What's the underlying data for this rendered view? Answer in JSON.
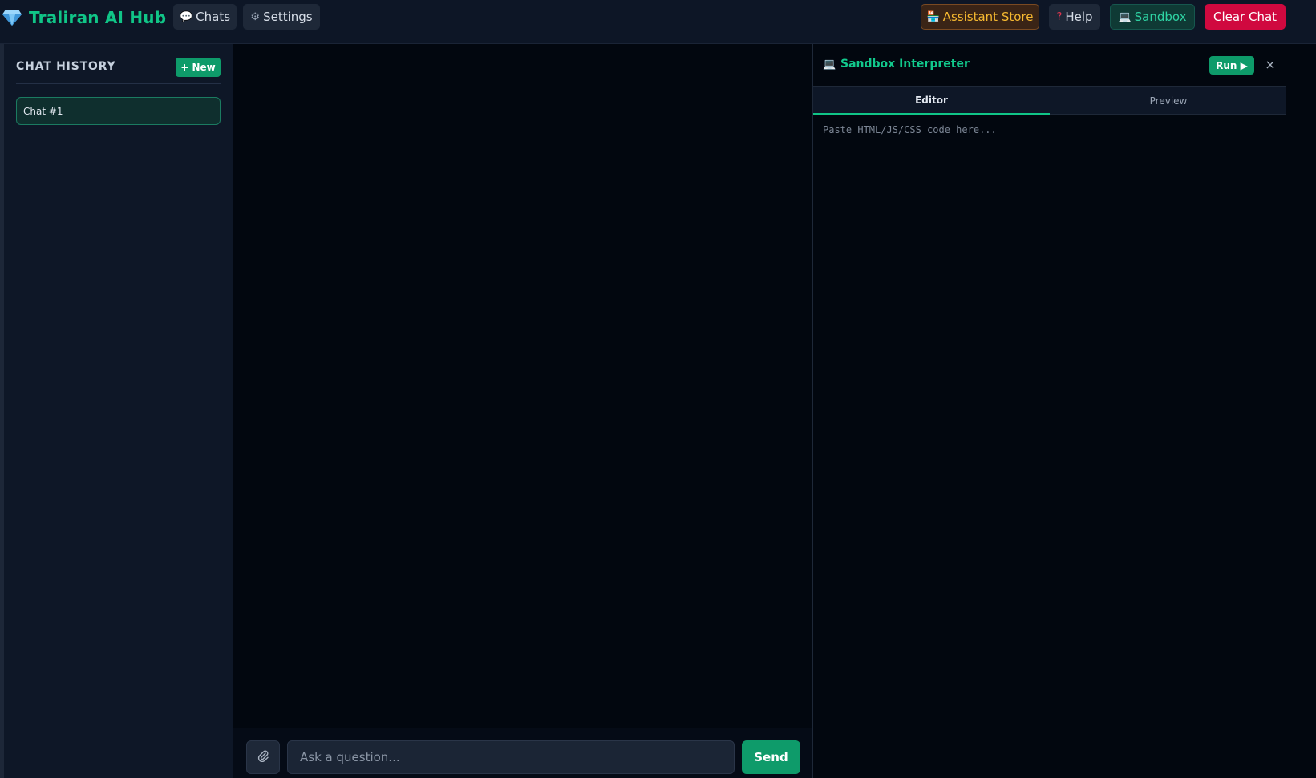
{
  "header": {
    "brand_title": "Traliran AI Hub",
    "brand_icon": "gem-icon",
    "nav": [
      {
        "label": "Chats",
        "icon": "speech-bubble-icon"
      },
      {
        "label": "Settings",
        "icon": "gear-icon"
      }
    ],
    "actions": {
      "store_label": "Assistant Store",
      "store_icon": "store-icon",
      "help_label": "Help",
      "help_icon": "question-icon",
      "sandbox_label": "Sandbox",
      "sandbox_icon": "laptop-icon",
      "clear_label": "Clear Chat"
    }
  },
  "sidebar": {
    "title": "CHAT HISTORY",
    "new_label": "+ New",
    "items": [
      {
        "label": "Chat #1",
        "active": true
      }
    ]
  },
  "composer": {
    "placeholder": "Ask a question...",
    "send_label": "Send",
    "attach_icon": "paperclip-icon"
  },
  "sandbox": {
    "title": "Sandbox Interpreter",
    "icon": "laptop-icon",
    "run_label": "Run ▶",
    "close_label": "×",
    "tabs": [
      {
        "label": "Editor",
        "active": true
      },
      {
        "label": "Preview",
        "active": false
      }
    ],
    "editor_placeholder": "Paste HTML/JS/CSS code here..."
  },
  "colors": {
    "accent": "#10c587",
    "primary_button": "#0e9b6a",
    "danger": "#d0093f",
    "store": "#f5b830",
    "background": "#02070f",
    "panel": "#0e1727"
  }
}
